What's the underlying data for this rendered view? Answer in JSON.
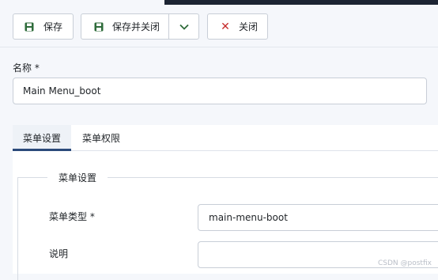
{
  "toolbar": {
    "save_label": "保存",
    "save_close_label": "保存并关闭",
    "close_label": "关闭"
  },
  "name_field": {
    "label": "名称 *",
    "value": "Main Menu_boot"
  },
  "tabs": [
    {
      "label": "菜单设置",
      "active": true
    },
    {
      "label": "菜单权限",
      "active": false
    }
  ],
  "fieldset": {
    "legend": "菜单设置",
    "menu_type_label": "菜单类型 *",
    "menu_type_value": "main-menu-boot",
    "description_label": "说明",
    "description_value": ""
  },
  "watermark": "CSDN @postfix",
  "colors": {
    "save_icon": "#2e6b3a",
    "close_icon": "#c52a2a",
    "active_tab_border": "#2b4a7a"
  }
}
